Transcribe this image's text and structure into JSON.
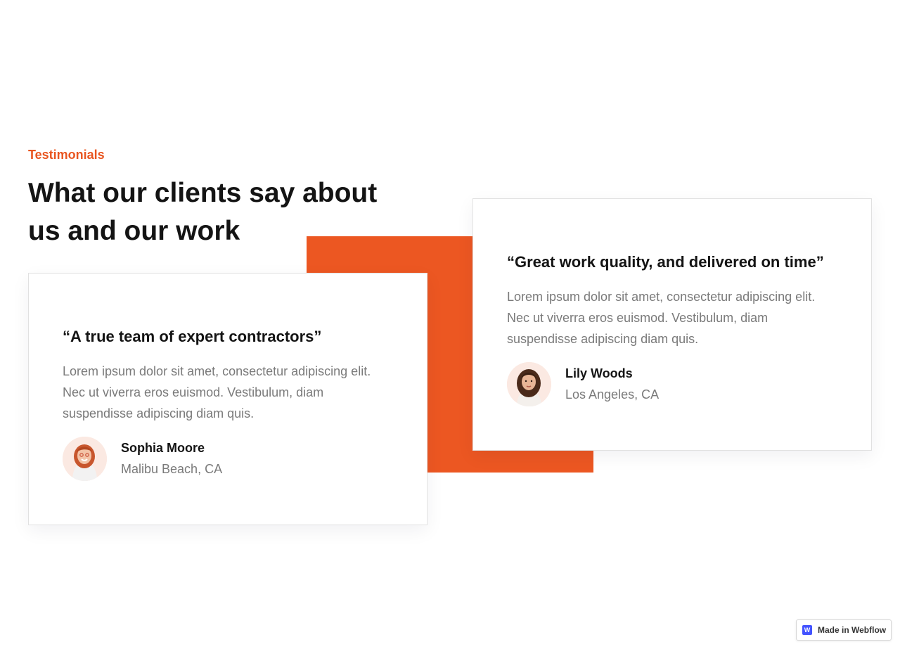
{
  "section": {
    "eyebrow": "Testimonials",
    "title": "What our clients say about us and our work"
  },
  "testimonials": [
    {
      "quote": "“A true team of expert contractors”",
      "body": "Lorem ipsum dolor sit amet, consectetur adipiscing elit. Nec ut viverra eros euismod. Vestibulum, diam suspendisse adipiscing diam quis.",
      "author": "Sophia Moore",
      "location": "Malibu Beach, CA"
    },
    {
      "quote": "“Great work quality, and delivered on time”",
      "body": "Lorem ipsum dolor sit amet, consectetur adipiscing elit. Nec ut viverra eros euismod. Vestibulum, diam suspendisse adipiscing diam quis.",
      "author": "Lily Woods",
      "location": "Los Angeles, CA"
    }
  ],
  "badge": {
    "label": "Made in Webflow",
    "logo_letter": "W"
  },
  "colors": {
    "accent": "#ec5722",
    "eyebrow": "#e9551f",
    "heading": "#141414",
    "body": "#7a7a7a"
  }
}
